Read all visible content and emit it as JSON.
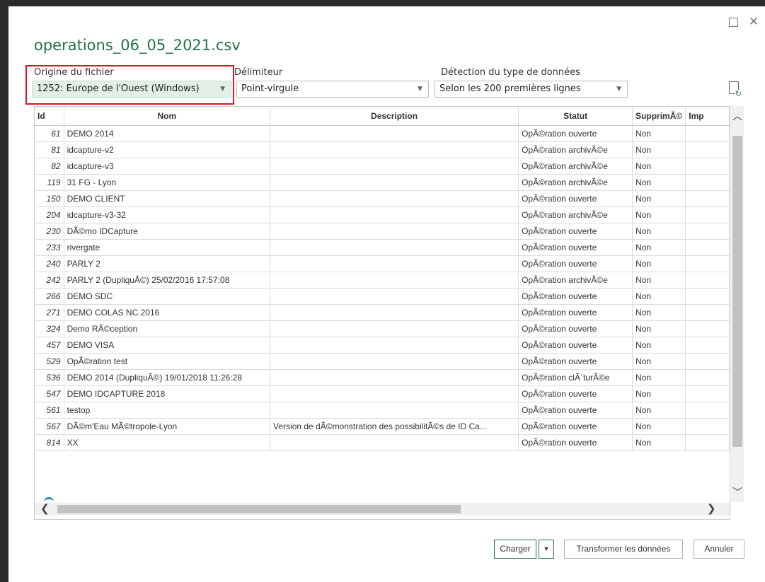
{
  "window": {
    "title": "operations_06_05_2021.csv"
  },
  "options": {
    "encoding_label": "Origine du fichier",
    "encoding_value": "1252: Europe de l'Ouest (Windows)",
    "delimiter_label": "Délimiteur",
    "delimiter_value": "Point-virgule",
    "detection_label": "Détection du type de données",
    "detection_value": "Selon les 200 premières lignes"
  },
  "table": {
    "columns": [
      "Id",
      "Nom",
      "Description",
      "Statut",
      "SupprimÃ©",
      "Imp"
    ],
    "rows": [
      {
        "id": "61",
        "nom": "DEMO 2014",
        "description": "",
        "statut": "OpÃ©ration ouverte",
        "supprime": "Non"
      },
      {
        "id": "81",
        "nom": "idcapture-v2",
        "description": "",
        "statut": "OpÃ©ration archivÃ©e",
        "supprime": "Non"
      },
      {
        "id": "82",
        "nom": "idcapture-v3",
        "description": "",
        "statut": "OpÃ©ration archivÃ©e",
        "supprime": "Non"
      },
      {
        "id": "119",
        "nom": "31 FG - Lyon",
        "description": "",
        "statut": "OpÃ©ration archivÃ©e",
        "supprime": "Non"
      },
      {
        "id": "150",
        "nom": "DEMO CLIENT",
        "description": "",
        "statut": "OpÃ©ration ouverte",
        "supprime": "Non"
      },
      {
        "id": "204",
        "nom": "idcapture-v3-32",
        "description": "",
        "statut": "OpÃ©ration archivÃ©e",
        "supprime": "Non"
      },
      {
        "id": "230",
        "nom": "DÃ©mo IDCapture",
        "description": "",
        "statut": "OpÃ©ration ouverte",
        "supprime": "Non"
      },
      {
        "id": "233",
        "nom": "rivergate",
        "description": "",
        "statut": "OpÃ©ration ouverte",
        "supprime": "Non"
      },
      {
        "id": "240",
        "nom": "PARLY 2",
        "description": "",
        "statut": "OpÃ©ration ouverte",
        "supprime": "Non"
      },
      {
        "id": "242",
        "nom": "PARLY 2 (DupliquÃ©) 25/02/2016 17:57:08",
        "description": "",
        "statut": "OpÃ©ration archivÃ©e",
        "supprime": "Non"
      },
      {
        "id": "266",
        "nom": "DEMO SDC",
        "description": "",
        "statut": "OpÃ©ration ouverte",
        "supprime": "Non"
      },
      {
        "id": "271",
        "nom": "DEMO COLAS NC 2016",
        "description": "",
        "statut": "OpÃ©ration ouverte",
        "supprime": "Non"
      },
      {
        "id": "324",
        "nom": "Demo RÃ©ception",
        "description": "",
        "statut": "OpÃ©ration ouverte",
        "supprime": "Non"
      },
      {
        "id": "457",
        "nom": "DEMO VISA",
        "description": "",
        "statut": "OpÃ©ration ouverte",
        "supprime": "Non"
      },
      {
        "id": "529",
        "nom": "OpÃ©ration test",
        "description": "",
        "statut": "OpÃ©ration ouverte",
        "supprime": "Non"
      },
      {
        "id": "536",
        "nom": "DEMO 2014 (DupliquÃ©) 19/01/2018 11:26:28",
        "description": "",
        "statut": "OpÃ©ration clÃ´turÃ©e",
        "supprime": "Non"
      },
      {
        "id": "547",
        "nom": "DEMO IDCAPTURE 2018",
        "description": "",
        "statut": "OpÃ©ration ouverte",
        "supprime": "Non"
      },
      {
        "id": "561",
        "nom": "testop",
        "description": "",
        "statut": "OpÃ©ration ouverte",
        "supprime": "Non"
      },
      {
        "id": "567",
        "nom": "DÃ©m'Eau MÃ©tropole-Lyon",
        "description": "Version de dÃ©monstration des possibilitÃ©s de ID Ca...",
        "statut": "OpÃ©ration ouverte",
        "supprime": "Non"
      },
      {
        "id": "814",
        "nom": "XX",
        "description": "",
        "statut": "OpÃ©ration ouverte",
        "supprime": "Non"
      }
    ]
  },
  "buttons": {
    "load": "Charger",
    "transform": "Transformer les données",
    "cancel": "Annuler"
  },
  "icons": {
    "maximize": "maximize-icon",
    "close": "close-icon",
    "refresh": "refresh-icon",
    "dropdown": "chevron-down-icon"
  }
}
